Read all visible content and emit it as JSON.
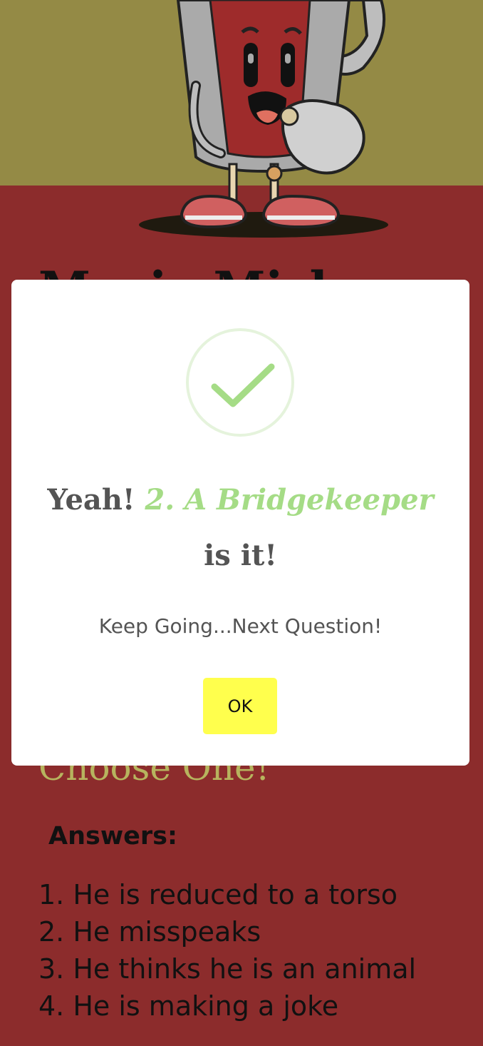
{
  "page": {
    "title_peek": "Movie Mishap",
    "choose_label": "Choose One!",
    "answers_heading": "Answers:",
    "answers": [
      "1. He is reduced to a torso",
      "2. He misspeaks",
      "3. He thinks he is an animal",
      "4. He is making a joke"
    ]
  },
  "modal": {
    "title_prefix": "Yeah! ",
    "title_answer": "2. A Bridgekeeper",
    "title_suffix": " is it!",
    "text": "Keep Going...Next Question!",
    "ok_label": "OK",
    "icon": "success-check-icon"
  },
  "colors": {
    "hero_bg": "#948a45",
    "page_bg": "#8c2c2c",
    "accent_green": "#a5dc86",
    "ok_button": "#ffff4d"
  }
}
